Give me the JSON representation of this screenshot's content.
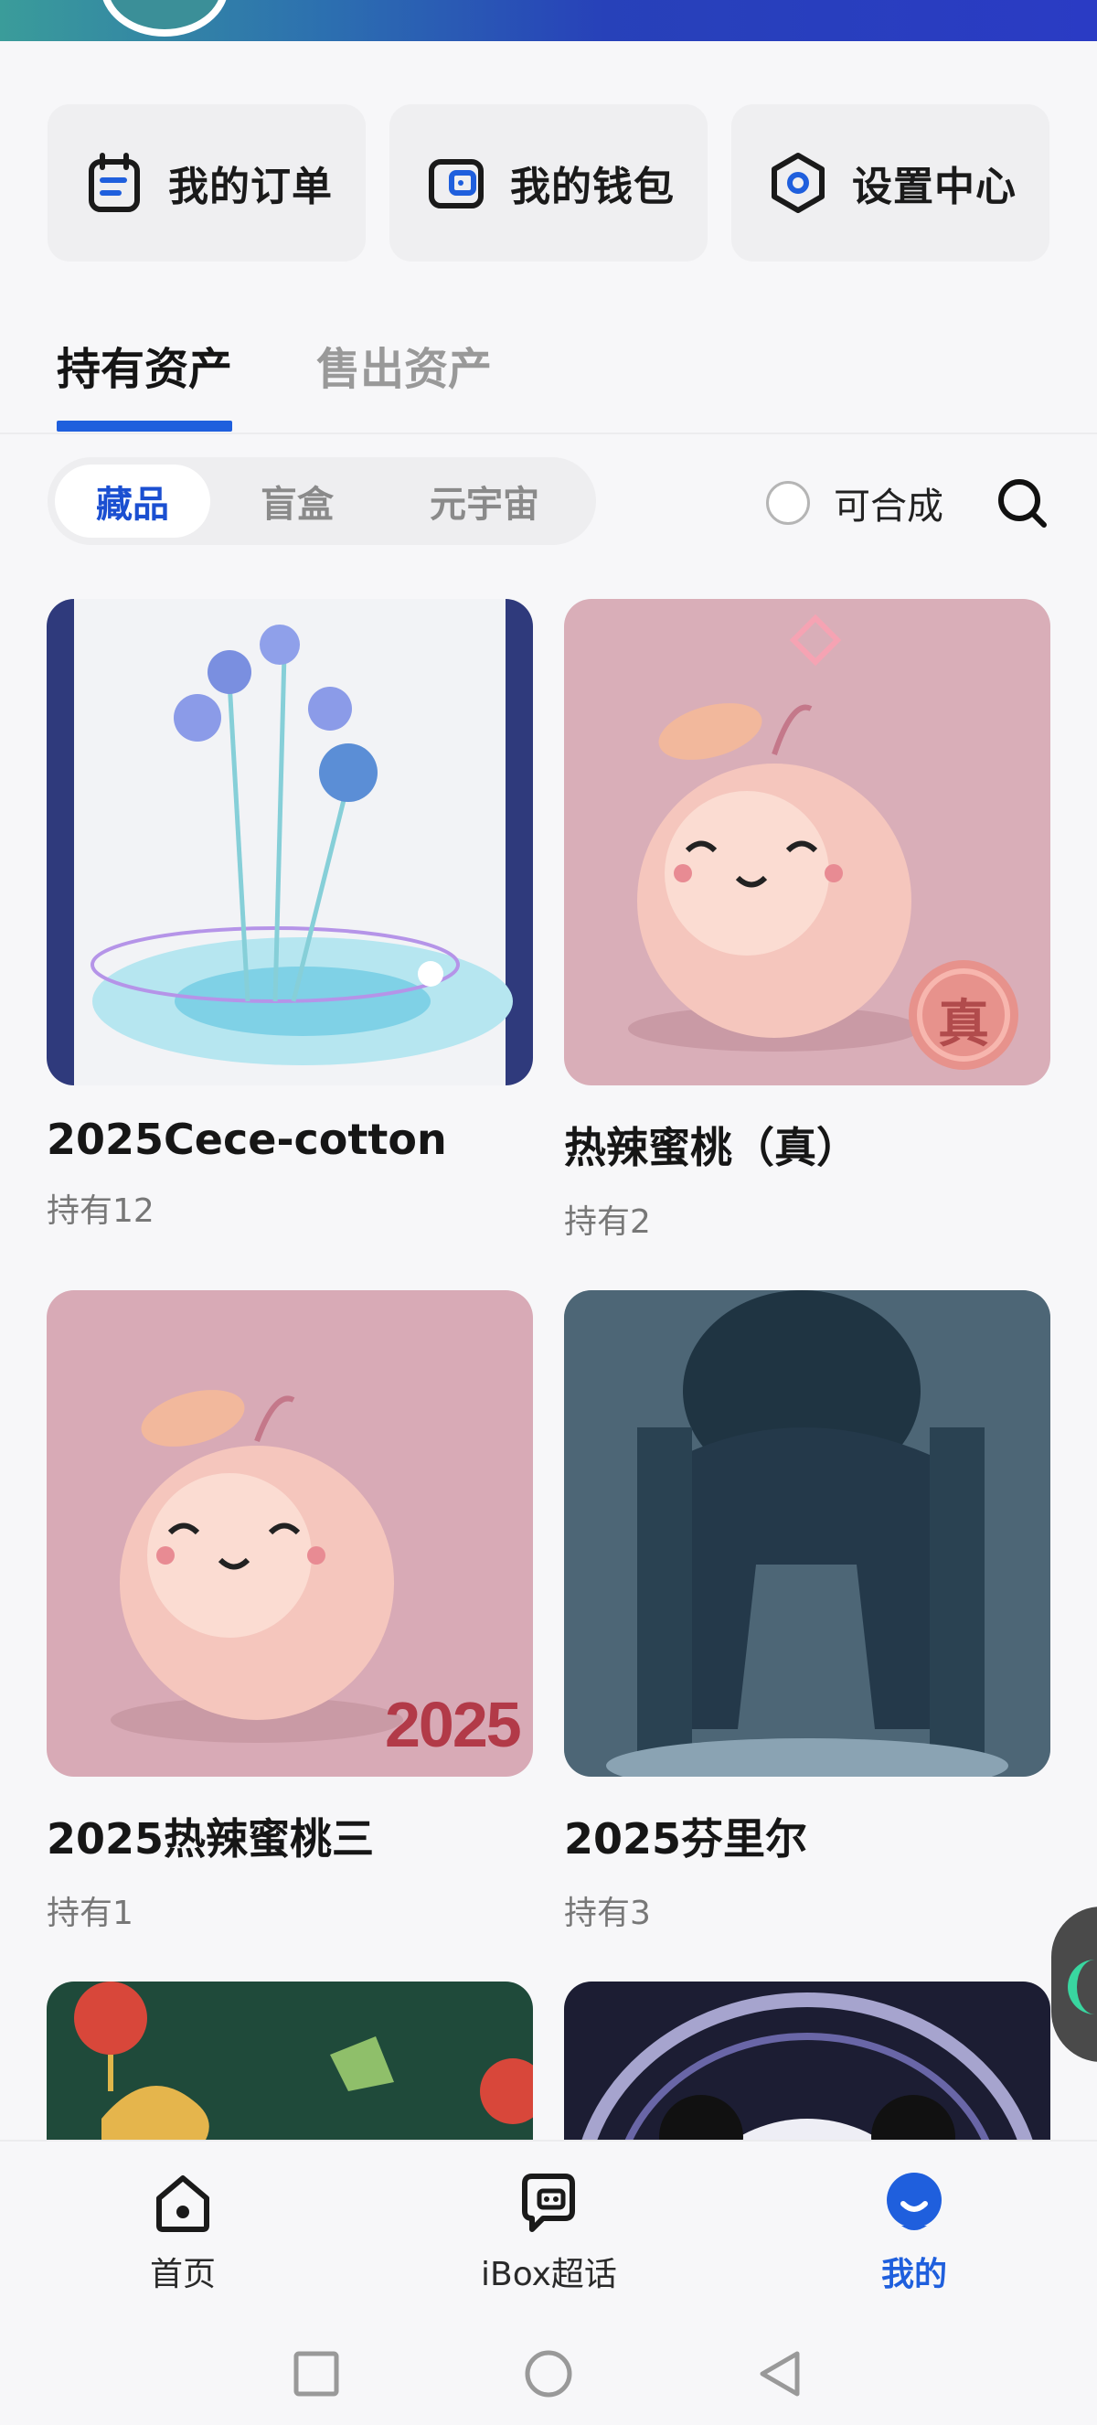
{
  "quick_actions": [
    {
      "label": "我的订单",
      "icon": "order-icon"
    },
    {
      "label": "我的钱包",
      "icon": "wallet-icon"
    },
    {
      "label": "设置中心",
      "icon": "settings-icon"
    }
  ],
  "main_tabs": [
    {
      "label": "持有资产",
      "active": true
    },
    {
      "label": "售出资产",
      "active": false
    }
  ],
  "sub_tabs": [
    {
      "label": "藏品",
      "active": true
    },
    {
      "label": "盲盒",
      "active": false
    },
    {
      "label": "元宇宙",
      "active": false
    }
  ],
  "filter": {
    "combine_label": "可合成",
    "combine_checked": false
  },
  "items": [
    {
      "title": "2025Cece-cotton",
      "holding": "持有12"
    },
    {
      "title": "热辣蜜桃（真）",
      "holding": "持有2"
    },
    {
      "title": "2025热辣蜜桃三",
      "holding": "持有1"
    },
    {
      "title": "2025芬里尔",
      "holding": "持有3"
    },
    {
      "title": "",
      "holding": ""
    },
    {
      "title": "",
      "holding": ""
    }
  ],
  "thumb_text": {
    "peach_true_seal": "真",
    "peach_year": "2025"
  },
  "bottom_nav": [
    {
      "label": "首页",
      "icon": "home-icon",
      "active": false
    },
    {
      "label": "iBox超话",
      "icon": "chat-icon",
      "active": false
    },
    {
      "label": "我的",
      "icon": "profile-icon",
      "active": true
    }
  ],
  "colors": {
    "accent": "#1f5fdd",
    "header_gradient_end": "#2a3bc4",
    "card_bg": "#efeff1"
  }
}
